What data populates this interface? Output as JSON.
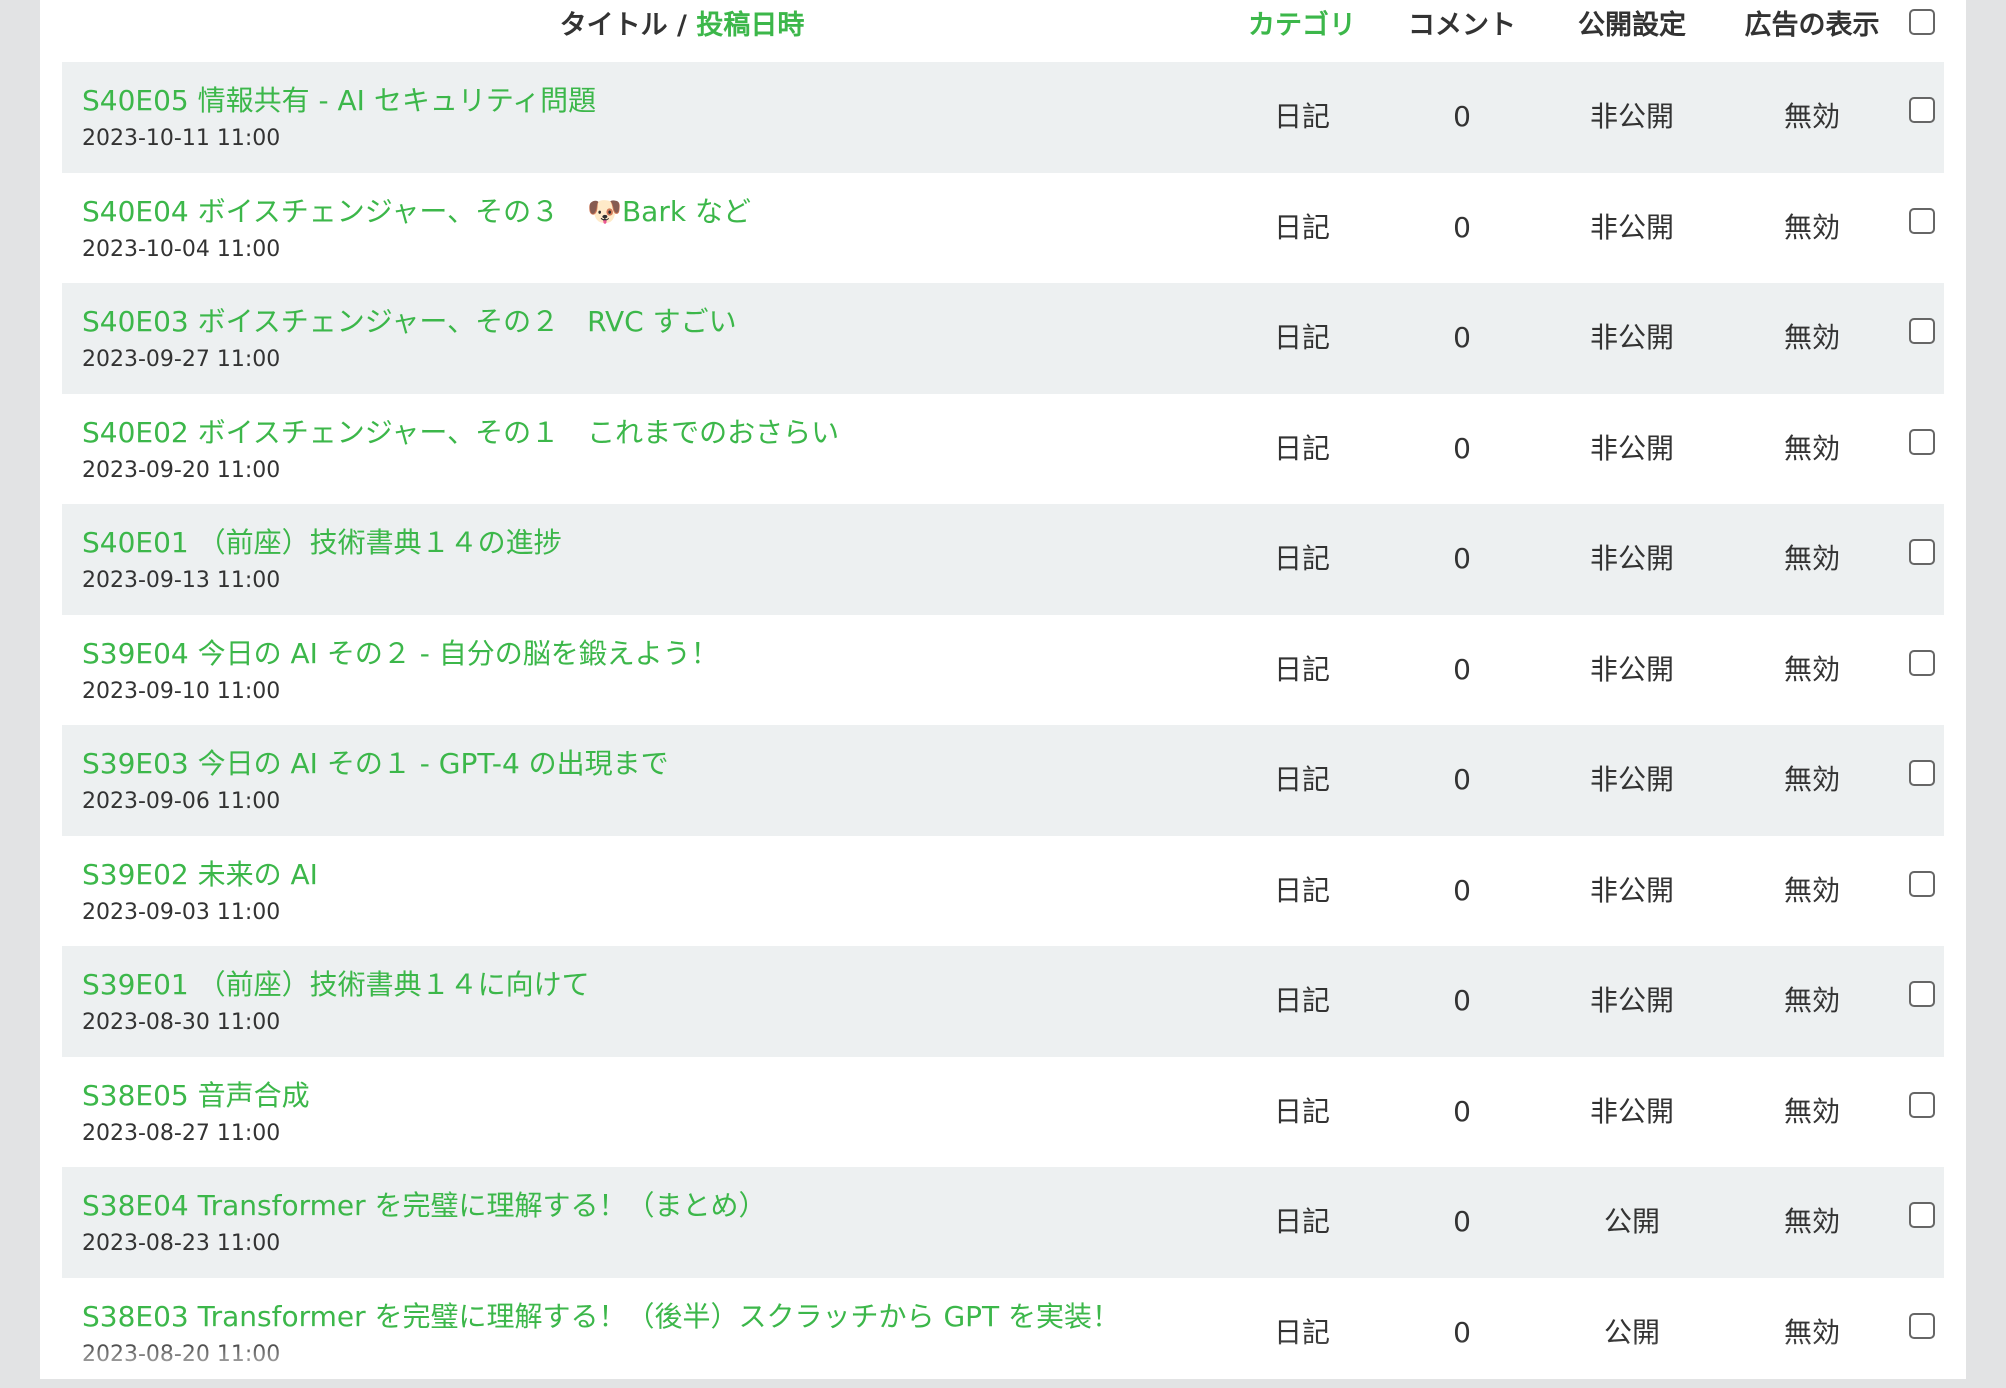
{
  "header": {
    "title_label": "タイトル",
    "separator": " / ",
    "date_label": "投稿日時",
    "category_label": "カテゴリ",
    "comments_label": "コメント",
    "visibility_label": "公開設定",
    "ads_label": "広告の表示"
  },
  "rows": [
    {
      "title": "S40E05 情報共有 - AI セキュリティ問題",
      "date": "2023-10-11 11:00",
      "category": "日記",
      "comments": "0",
      "visibility": "非公開",
      "ads": "無効"
    },
    {
      "title": "S40E04 ボイスチェンジャー、その３　🐶Bark など",
      "date": "2023-10-04 11:00",
      "category": "日記",
      "comments": "0",
      "visibility": "非公開",
      "ads": "無効"
    },
    {
      "title": "S40E03 ボイスチェンジャー、その２　RVC すごい",
      "date": "2023-09-27 11:00",
      "category": "日記",
      "comments": "0",
      "visibility": "非公開",
      "ads": "無効"
    },
    {
      "title": "S40E02 ボイスチェンジャー、その１　これまでのおさらい",
      "date": "2023-09-20 11:00",
      "category": "日記",
      "comments": "0",
      "visibility": "非公開",
      "ads": "無効"
    },
    {
      "title": "S40E01 （前座）技術書典１４の進捗",
      "date": "2023-09-13 11:00",
      "category": "日記",
      "comments": "0",
      "visibility": "非公開",
      "ads": "無効"
    },
    {
      "title": "S39E04 今日の AI その２ - 自分の脳を鍛えよう！",
      "date": "2023-09-10 11:00",
      "category": "日記",
      "comments": "0",
      "visibility": "非公開",
      "ads": "無効"
    },
    {
      "title": "S39E03 今日の AI その１ - GPT-4 の出現まで",
      "date": "2023-09-06 11:00",
      "category": "日記",
      "comments": "0",
      "visibility": "非公開",
      "ads": "無効"
    },
    {
      "title": "S39E02 未来の AI",
      "date": "2023-09-03 11:00",
      "category": "日記",
      "comments": "0",
      "visibility": "非公開",
      "ads": "無効"
    },
    {
      "title": "S39E01 （前座）技術書典１４に向けて",
      "date": "2023-08-30 11:00",
      "category": "日記",
      "comments": "0",
      "visibility": "非公開",
      "ads": "無効"
    },
    {
      "title": "S38E05 音声合成",
      "date": "2023-08-27 11:00",
      "category": "日記",
      "comments": "0",
      "visibility": "非公開",
      "ads": "無効"
    },
    {
      "title": "S38E04 Transformer を完璧に理解する！（まとめ）",
      "date": "2023-08-23 11:00",
      "category": "日記",
      "comments": "0",
      "visibility": "公開",
      "ads": "無効"
    },
    {
      "title": "S38E03 Transformer を完璧に理解する！（後半）スクラッチから GPT を実装！",
      "date": "2023-08-20 11:00",
      "category": "日記",
      "comments": "0",
      "visibility": "公開",
      "ads": "無効"
    }
  ]
}
